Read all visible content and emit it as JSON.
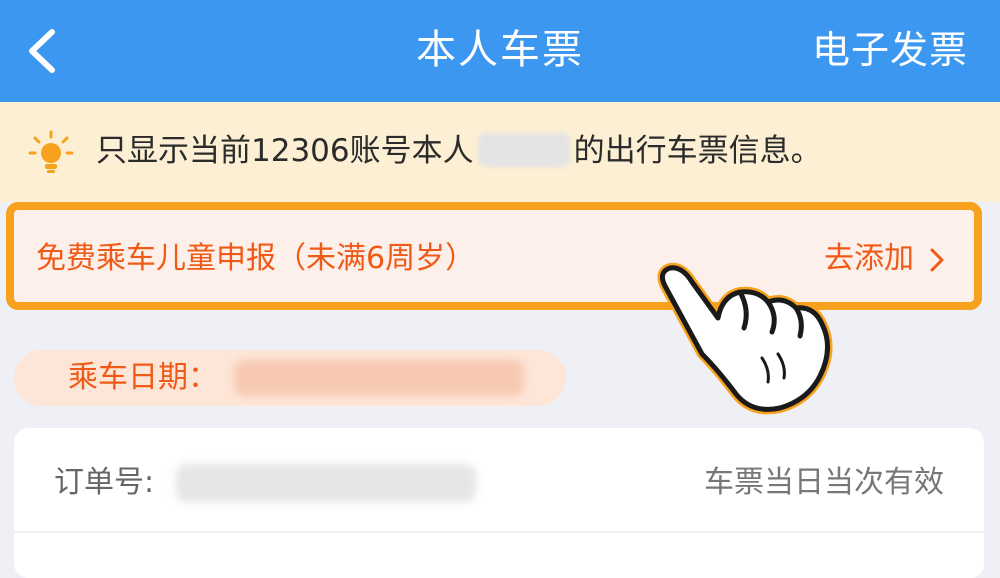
{
  "header": {
    "title": "本人车票",
    "invoice_label": "电子发票",
    "back_icon": "chevron-left-icon"
  },
  "notice": {
    "icon": "lightbulb-icon",
    "text_before": "只显示当前12306账号本人",
    "text_after": "的出行车票信息。"
  },
  "child_declaration": {
    "label": "免费乘车儿童申报（未满6周岁）",
    "action_label": "去添加",
    "chevron_icon": "chevron-right-icon"
  },
  "hand_icon": "pointing-hand-icon",
  "ride_date": {
    "label": "乘车日期："
  },
  "order": {
    "label": "订单号:",
    "validity": "车票当日当次有效"
  },
  "colors": {
    "header_bg": "#3c97f0",
    "notice_bg": "#fcefd3",
    "accent_orange": "#f05a16",
    "highlight_border": "#f7a11c"
  }
}
